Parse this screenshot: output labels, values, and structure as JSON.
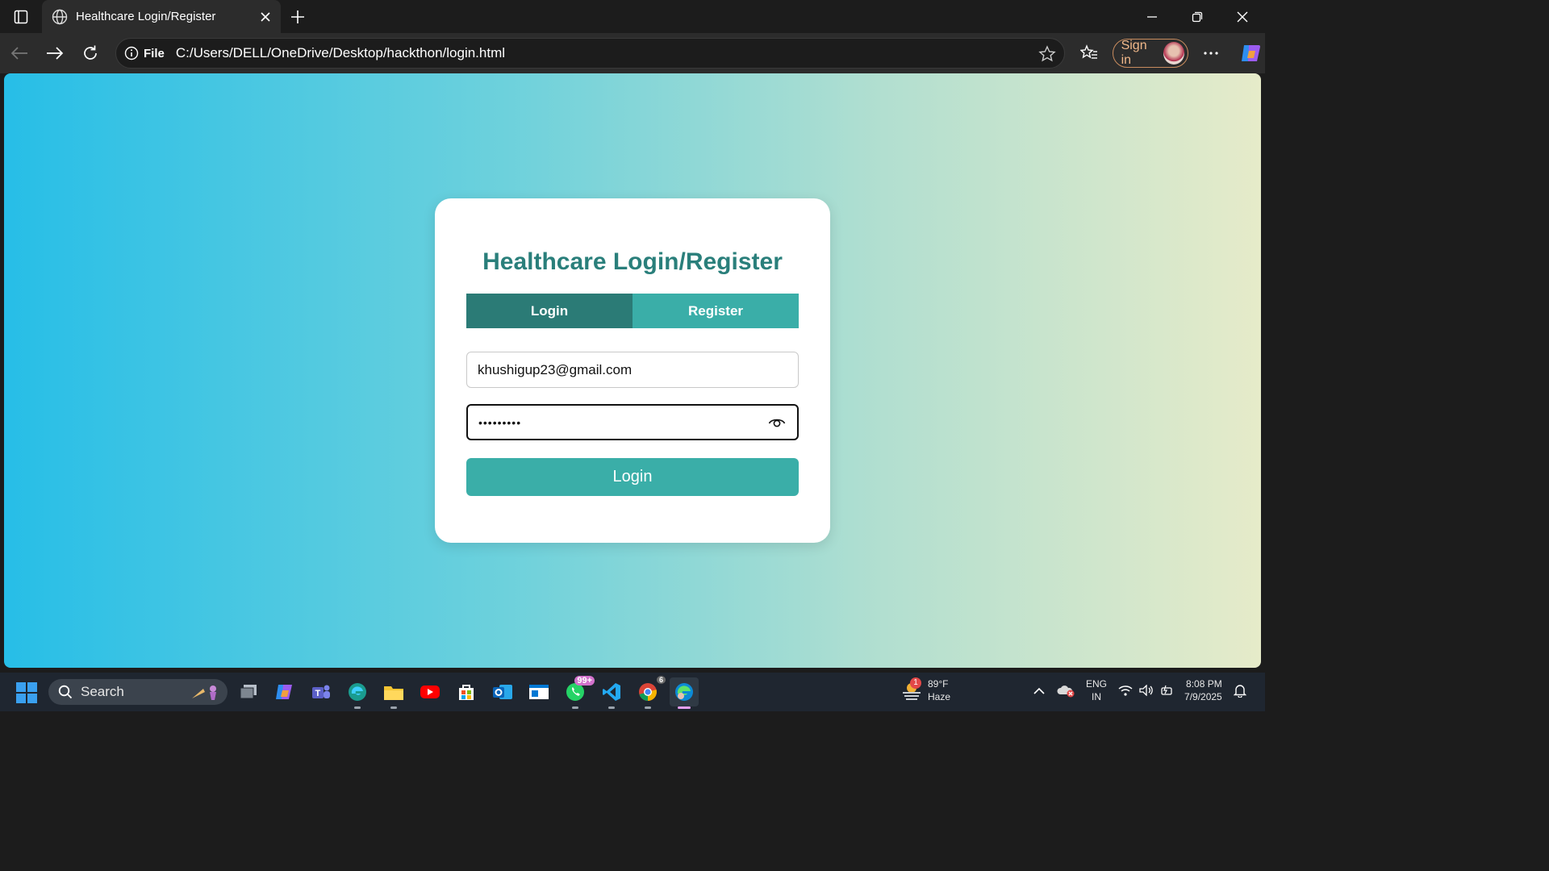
{
  "browser": {
    "tab_title": "Healthcare Login/Register",
    "url_scheme_label": "File",
    "url": "C:/Users/DELL/OneDrive/Desktop/hackthon/login.html",
    "sign_in_label": "Sign in"
  },
  "page": {
    "title": "Healthcare Login/Register",
    "tabs": {
      "login": "Login",
      "register": "Register"
    },
    "email_value": "khushigup23@gmail.com",
    "password_value": "•••••••••",
    "submit_label": "Login",
    "colors": {
      "title": "#2a7f7b",
      "tab_active": "#2b7b76",
      "tab_inactive": "#3aaea8",
      "button": "#3aaea8"
    }
  },
  "taskbar": {
    "search_label": "Search",
    "whatsapp_badge": "99+",
    "chrome_badge": "6",
    "weather_badge": "1",
    "weather_temp": "89°F",
    "weather_desc": "Haze",
    "lang_top": "ENG",
    "lang_bottom": "IN",
    "time": "8:08 PM",
    "date": "7/9/2025"
  }
}
